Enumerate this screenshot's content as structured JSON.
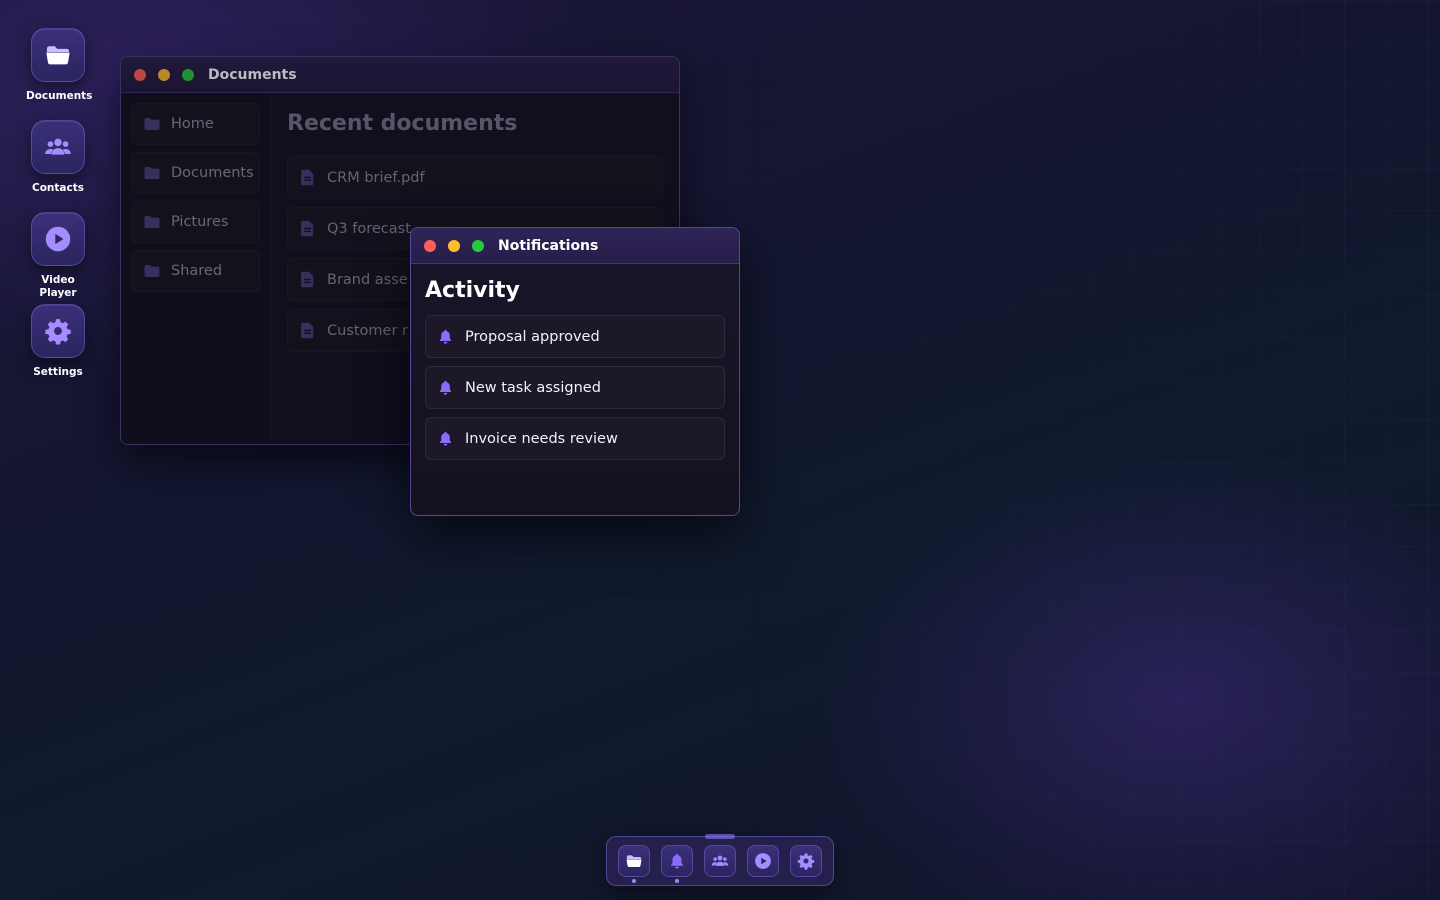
{
  "theme": {
    "accent": "#8b6cff",
    "accent_dark": "#5a44c4",
    "close": "#ff5f57",
    "minimize": "#febc2e",
    "maximize": "#28c840"
  },
  "desktop": {
    "icons": [
      {
        "label": "Documents",
        "icon": "folder-icon"
      },
      {
        "label": "Contacts",
        "icon": "users-icon"
      },
      {
        "label": "Video Player",
        "icon": "play-icon"
      },
      {
        "label": "Settings",
        "icon": "gear-icon"
      }
    ]
  },
  "documents_window": {
    "title": "Documents",
    "sidebar": [
      {
        "label": "Home",
        "icon": "folder-icon"
      },
      {
        "label": "Documents",
        "icon": "folder-icon"
      },
      {
        "label": "Pictures",
        "icon": "folder-icon"
      },
      {
        "label": "Shared",
        "icon": "folder-icon"
      }
    ],
    "heading": "Recent documents",
    "files": [
      {
        "name": "CRM brief.pdf",
        "icon": "file-icon"
      },
      {
        "name": "Q3 forecast",
        "icon": "file-icon"
      },
      {
        "name": "Brand asse",
        "icon": "file-icon"
      },
      {
        "name": "Customer r",
        "icon": "file-icon"
      }
    ]
  },
  "notifications_window": {
    "title": "Notifications",
    "heading": "Activity",
    "items": [
      {
        "text": "Proposal approved",
        "icon": "bell-icon"
      },
      {
        "text": "New task assigned",
        "icon": "bell-icon"
      },
      {
        "text": "Invoice needs review",
        "icon": "bell-icon"
      }
    ]
  },
  "dock": {
    "items": [
      {
        "app": "Documents",
        "icon": "folder-icon",
        "running": true
      },
      {
        "app": "Notifications",
        "icon": "bell-icon",
        "running": true
      },
      {
        "app": "Contacts",
        "icon": "users-icon",
        "running": false
      },
      {
        "app": "Video Player",
        "icon": "play-icon",
        "running": false
      },
      {
        "app": "Settings",
        "icon": "gear-icon",
        "running": false
      }
    ]
  }
}
